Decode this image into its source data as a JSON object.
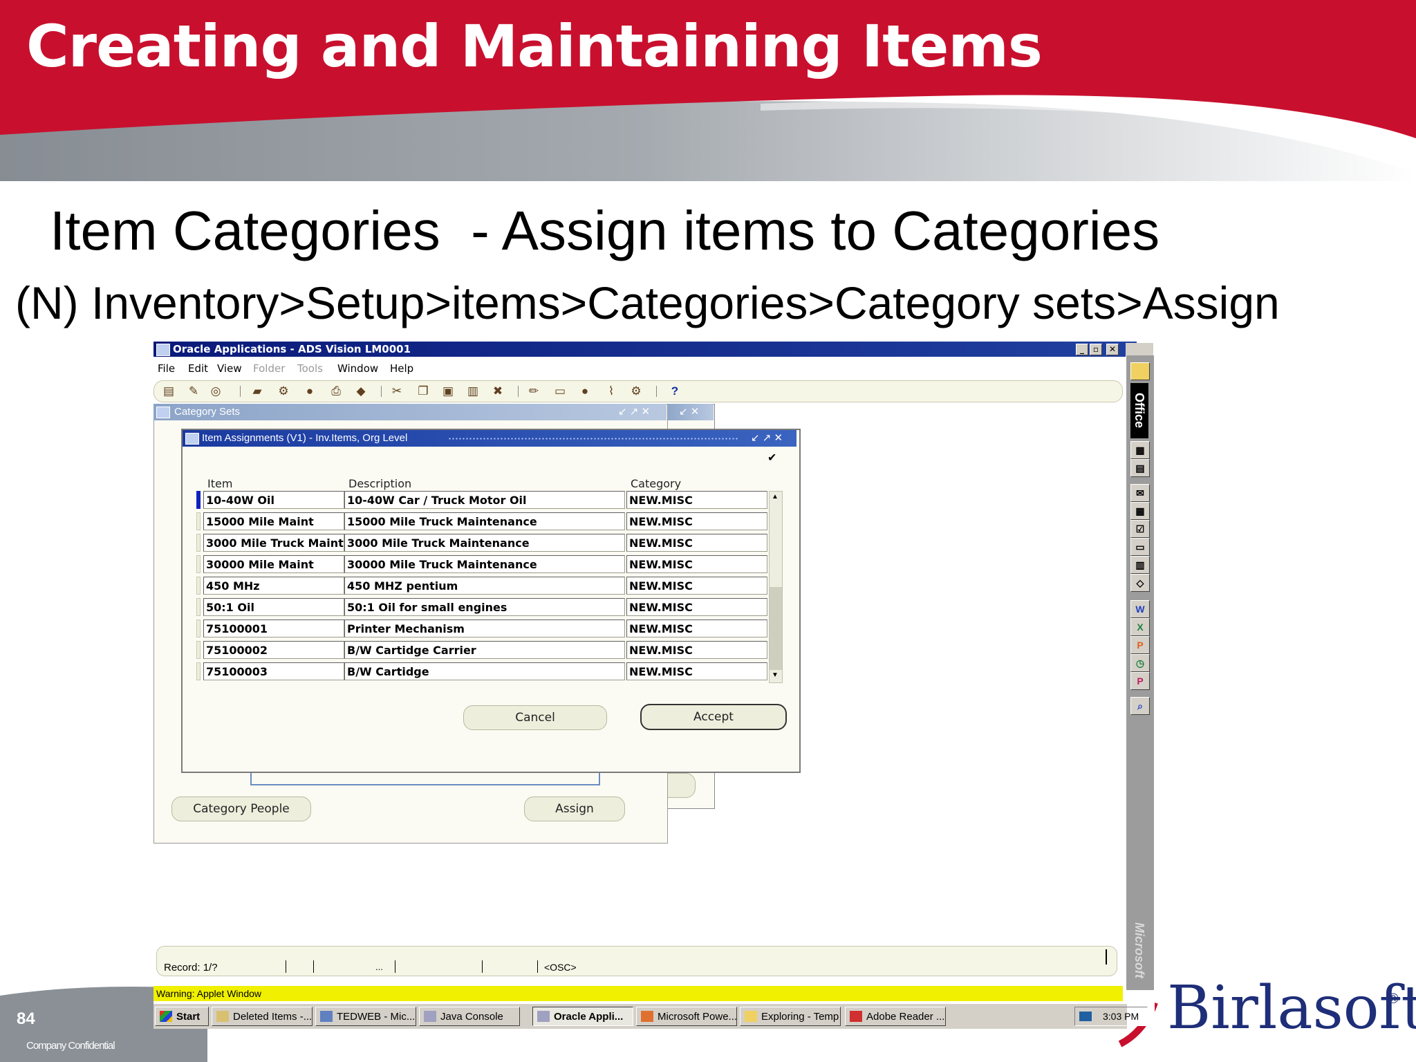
{
  "slide": {
    "title": "Creating and Maintaining Items",
    "subtitle": "Item Categories  - Assign items to Categories",
    "nav_path": "(N) Inventory>Setup>items>Categories>Category sets>Assign",
    "page_number": "84",
    "confidential": "Company Confidential",
    "brand": "Birlasoft",
    "brand_reg": "®",
    "colors": {
      "header_red": "#c8102e",
      "header_grey": "#8a9096",
      "brand": "#1e2e78"
    }
  },
  "app": {
    "title": "Oracle Applications - ADS Vision LM0001",
    "menu": [
      "File",
      "Edit",
      "View",
      "Folder",
      "Tools",
      "Window",
      "Help"
    ],
    "menu_disabled": [
      "Folder",
      "Tools"
    ],
    "help_icon": "?"
  },
  "category_sets": {
    "title": "Category Sets",
    "buttons": {
      "category_people": "Category People",
      "assign": "Assign"
    }
  },
  "item_assignments": {
    "title": "Item Assignments (V1) - Inv.Items, Org Level",
    "columns": [
      "Item",
      "Description",
      "Category"
    ],
    "rows": [
      {
        "item": "10-40W Oil",
        "description": "10-40W Car / Truck Motor Oil",
        "category": "NEW.MISC"
      },
      {
        "item": "15000 Mile Maint",
        "description": "15000 Mile Truck Maintenance",
        "category": "NEW.MISC"
      },
      {
        "item": "3000 Mile Truck Maint",
        "description": "3000 Mile Truck Maintenance",
        "category": "NEW.MISC"
      },
      {
        "item": "30000 Mile Maint",
        "description": "30000 Mile Truck Maintenance",
        "category": "NEW.MISC"
      },
      {
        "item": "450 MHz",
        "description": "450 MHZ pentium",
        "category": "NEW.MISC"
      },
      {
        "item": "50:1 Oil",
        "description": "50:1 Oil for small engines",
        "category": "NEW.MISC"
      },
      {
        "item": "75100001",
        "description": "Printer Mechanism",
        "category": "NEW.MISC"
      },
      {
        "item": "75100002",
        "description": "B/W Cartidge Carrier",
        "category": "NEW.MISC"
      },
      {
        "item": "75100003",
        "description": "B/W Cartidge",
        "category": "NEW.MISC"
      }
    ],
    "buttons": {
      "cancel": "Cancel",
      "accept": "Accept"
    }
  },
  "status": {
    "record": "Record: 1/?",
    "ellipsis": "...",
    "osc": "<OSC>",
    "warning": "Warning: Applet Window"
  },
  "taskbar": {
    "start": "Start",
    "tasks": [
      "Deleted Items -...",
      "TEDWEB - Mic...",
      "Java Console",
      "Oracle Appli...",
      "Microsoft Powe...",
      "Exploring - Temp",
      "Adobe Reader ..."
    ],
    "clock": "3:03 PM"
  },
  "office_bar": {
    "label": "Office",
    "footer": "Microsoft"
  }
}
